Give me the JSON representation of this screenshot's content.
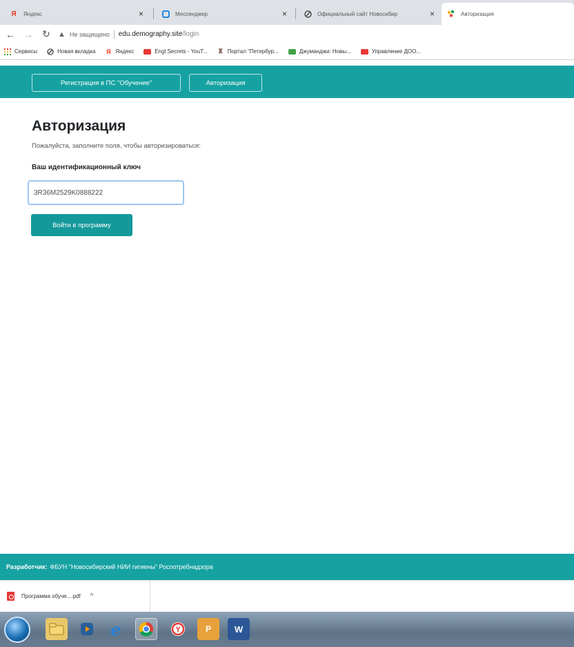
{
  "browser": {
    "tabs": [
      {
        "title": "Яндекс",
        "favicon": "yandex-icon",
        "active": false
      },
      {
        "title": "Мессенджер",
        "favicon": "messenger-icon",
        "active": false
      },
      {
        "title": "Официальный сайт Новосибир",
        "favicon": "globe-icon",
        "active": false
      },
      {
        "title": "Авторизация",
        "favicon": "site-icon",
        "active": true
      }
    ],
    "address": {
      "security": "Не защищено",
      "host": "edu.demography.site",
      "path": "/login"
    },
    "bookmarks": [
      {
        "label": "Сервисы",
        "icon": "apps-icon"
      },
      {
        "label": "Новая вкладка",
        "icon": "globe-icon"
      },
      {
        "label": "Яндекс",
        "icon": "yandex-icon"
      },
      {
        "label": "Engl Secrets - YouT...",
        "icon": "youtube-icon"
      },
      {
        "label": "Портал \"Петербур...",
        "icon": "portal-icon"
      },
      {
        "label": "Джуманджи: Новы...",
        "icon": "video-icon"
      },
      {
        "label": "Управление ДОО...",
        "icon": "youtube-icon"
      }
    ]
  },
  "site": {
    "nav": {
      "register": "Регистрация в ПС \"Обучение\"",
      "login": "Авторизация"
    },
    "main": {
      "title": "Авторизация",
      "subtitle": "Пожалуйста, заполните поля, чтобы авторизироваться:",
      "key_label": "Ваш идентификационный ключ",
      "key_value": "3R36M2529K0888222",
      "submit": "Войти в программу"
    },
    "footer": {
      "label": "Разработчик:",
      "text": "ФБУН \"Новосибирский НИИ гигиены\" Роспотребнадзора"
    }
  },
  "downloads": {
    "file": "Программа обуче....pdf"
  },
  "colors": {
    "brand": "#17a2a2",
    "button": "#14999b"
  }
}
